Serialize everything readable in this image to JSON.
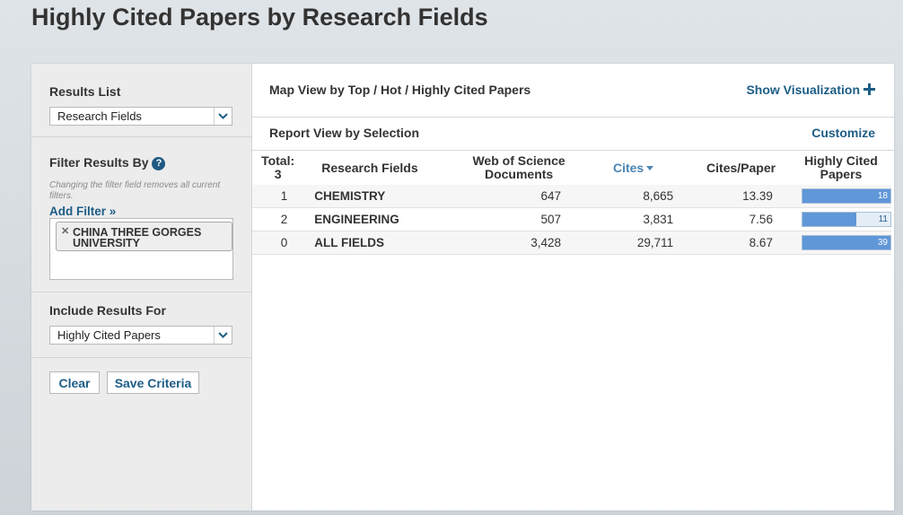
{
  "page": {
    "title": "Highly Cited Papers by Research Fields"
  },
  "sidebar": {
    "results_list": {
      "label": "Results List",
      "value": "Research Fields"
    },
    "filter": {
      "label": "Filter Results By",
      "hint": "Changing the filter field removes all current filters.",
      "add_filter": "Add Filter »",
      "tags": [
        "CHINA THREE GORGES UNIVERSITY"
      ]
    },
    "include": {
      "label": "Include Results For",
      "value": "Highly Cited Papers"
    },
    "buttons": {
      "clear": "Clear",
      "save": "Save Criteria"
    }
  },
  "main": {
    "map_view": {
      "title": "Map View by Top / Hot / Highly Cited Papers",
      "action": "Show Visualization"
    },
    "report_view": {
      "title": "Report View by Selection",
      "action": "Customize"
    },
    "table": {
      "headers": {
        "total": "Total:",
        "total_count": "3",
        "field": "Research Fields",
        "docs_1": "Web of Science",
        "docs_2": "Documents",
        "cites": "Cites",
        "cites_per_paper": "Cites/Paper",
        "hcp_1": "Highly Cited",
        "hcp_2": "Papers"
      },
      "rows": [
        {
          "rank": "1",
          "field": "CHEMISTRY",
          "docs": "647",
          "cites": "8,665",
          "cites_per_paper": "13.39",
          "hcp": "18",
          "hcp_value": 18
        },
        {
          "rank": "2",
          "field": "ENGINEERING",
          "docs": "507",
          "cites": "3,831",
          "cites_per_paper": "7.56",
          "hcp": "11",
          "hcp_value": 11
        },
        {
          "rank": "0",
          "field": "ALL FIELDS",
          "docs": "3,428",
          "cites": "29,711",
          "cites_per_paper": "8.67",
          "hcp": "39",
          "hcp_value": 39
        }
      ],
      "hcp_max": 18
    }
  },
  "colors": {
    "accent": "#1d5d86",
    "bar_fill": "#5f97d8",
    "sort_header": "#4a86b6"
  }
}
